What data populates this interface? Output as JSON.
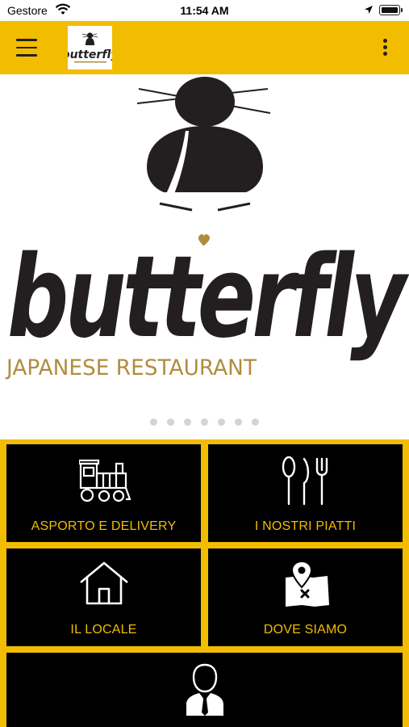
{
  "status": {
    "carrier": "Gestore",
    "time": "11:54 AM"
  },
  "brand": {
    "name": "butterfly",
    "subtitle": "JAPANESE RESTAURANT",
    "accent": "#f2bc00",
    "gold": "#b08d3e",
    "dark": "#231f20"
  },
  "carousel": {
    "pages": 7,
    "active": 0
  },
  "menu": [
    {
      "label": "ASPORTO E DELIVERY",
      "icon": "train-icon"
    },
    {
      "label": "I NOSTRI PIATTI",
      "icon": "cutlery-icon"
    },
    {
      "label": "IL LOCALE",
      "icon": "house-icon"
    },
    {
      "label": "DOVE SIAMO",
      "icon": "map-pin-icon"
    },
    {
      "label": "",
      "icon": "person-icon"
    }
  ]
}
